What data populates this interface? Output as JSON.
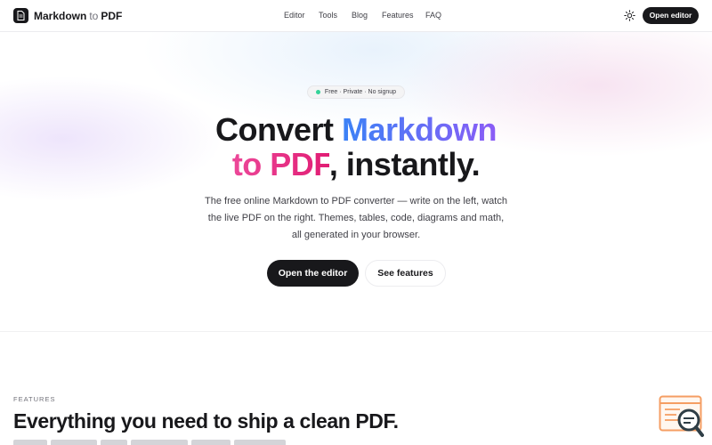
{
  "header": {
    "logo": {
      "name_a": "Markdown",
      "name_to": "to",
      "name_b": "PDF",
      "icon": "document-icon"
    },
    "nav": [
      "Editor",
      "Tools",
      "Blog",
      "Features",
      "FAQ"
    ],
    "theme_icon": "sun-icon",
    "open_editor_label": "Open editor"
  },
  "hero": {
    "badge": "Free · Private · No signup",
    "title_part1": "Convert ",
    "title_part2": "Markdown",
    "title_part3": "to PDF",
    "title_part4": ", instantly.",
    "description": [
      "The free online Markdown to PDF converter — write on the left, watch",
      "the live PDF on the right. Themes, tables, code, diagrams and math,",
      "all generated in your browser."
    ],
    "primary_cta": "Open the editor",
    "secondary_cta": "See features"
  },
  "features": {
    "eyebrow": "FEATURES",
    "title": "Everything you need to ship a clean PDF."
  },
  "floating_widget": {
    "icon": "search-document-icon"
  },
  "colors": {
    "accent_blue": "#3b82f6",
    "accent_purple": "#8b5cf6",
    "accent_pink": "#ec4899",
    "dark": "#18181b",
    "widget_orange": "#f59e63"
  }
}
